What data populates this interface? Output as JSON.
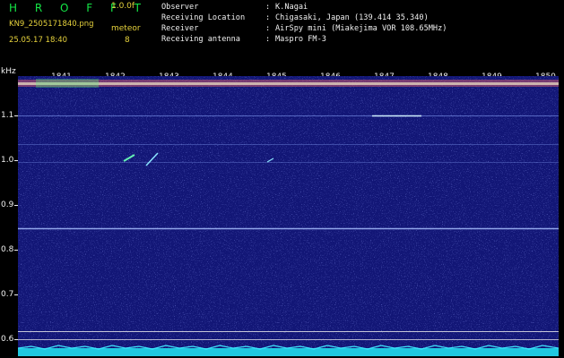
{
  "header": {
    "brand": "H R O F F T",
    "version": "1.0.0f",
    "filename": "KN9_2505171840.png",
    "meteor_label": "meteor",
    "timestamp": "25.05.17 18:40",
    "meteor_count": "8"
  },
  "info": [
    {
      "key": "Observer",
      "value": "K.Nagai"
    },
    {
      "key": "Receiving Location",
      "value": "Chigasaki, Japan (139.414 35.340)"
    },
    {
      "key": "Receiver",
      "value": "AirSpy mini (Miakejima VOR 108.65MHz)"
    },
    {
      "key": "Receiving antenna",
      "value": "Maspro FM-3"
    }
  ],
  "y_axis": {
    "unit": "kHz",
    "ticks": [
      "1.1",
      "1.0",
      "0.9",
      "0.8",
      "0.7",
      "0.6"
    ]
  },
  "x_axis": {
    "ticks": [
      "1841",
      "1842",
      "1843",
      "1844",
      "1845",
      "1846",
      "1847",
      "1848",
      "1849",
      "1850"
    ]
  },
  "colors": {
    "background": "#121676",
    "signal_line": "#b4c8ff",
    "meteor": "#64f0b4",
    "noise_floor": "#20c8e0"
  }
}
